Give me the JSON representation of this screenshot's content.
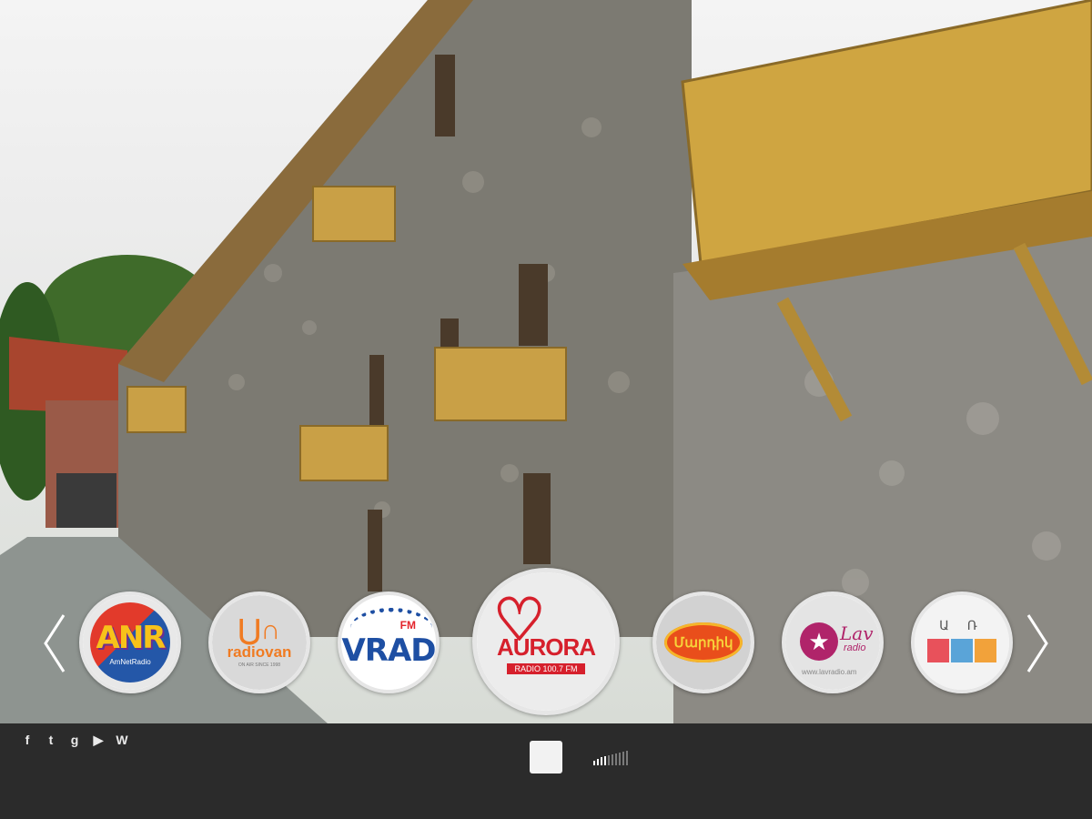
{
  "carousel": {
    "prev_icon": "chevron-left-icon",
    "next_icon": "chevron-right-icon",
    "stations": [
      {
        "id": "anr",
        "logo_text": "ANR",
        "sub_text": "AmNetRadio",
        "selected": false
      },
      {
        "id": "radiovan",
        "logo_text": "radiovan",
        "sub_text": "ON AIR SINCE 1998",
        "selected": false
      },
      {
        "id": "vrad",
        "logo_text": "VRAD",
        "sub_text": "FM",
        "selected": false
      },
      {
        "id": "aurora",
        "logo_text": "AURORA",
        "sub_text": "RADIO 100.7 FM",
        "selected": true
      },
      {
        "id": "mh",
        "logo_text": "Մարդիկ",
        "sub_text": "",
        "selected": false
      },
      {
        "id": "lav",
        "logo_text": "Lav",
        "sub_text": "radio",
        "url": "www.lavradio.am",
        "selected": false
      },
      {
        "id": "ur",
        "logo_text": "Ա Ռ",
        "sub_text": "",
        "selected": false
      }
    ]
  },
  "footer": {
    "social": [
      {
        "name": "facebook-icon",
        "glyph": "f"
      },
      {
        "name": "twitter-icon",
        "glyph": "t"
      },
      {
        "name": "google-plus-icon",
        "glyph": "g"
      },
      {
        "name": "youtube-icon",
        "glyph": "▶"
      },
      {
        "name": "wordpress-icon",
        "glyph": "W"
      }
    ],
    "player": {
      "state": "playing",
      "control_icon": "stop-icon",
      "volume_level": 0.4
    }
  },
  "colors": {
    "footer_bg": "#2b2b2b",
    "stop_button": "#f2f2f2",
    "aurora_red": "#d6202c"
  }
}
